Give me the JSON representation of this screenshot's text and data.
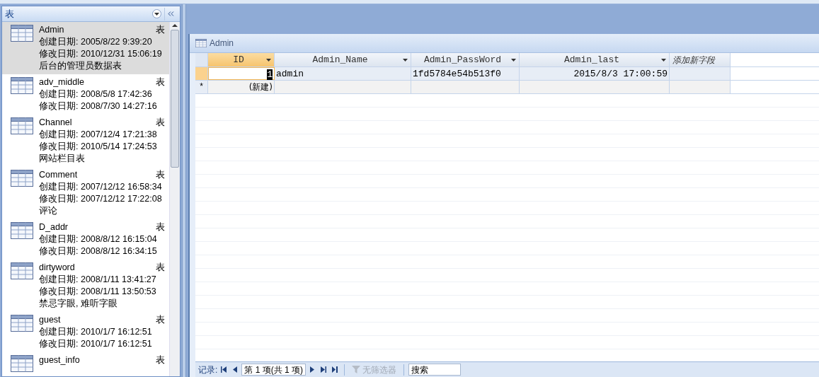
{
  "navigation_pane": {
    "title": "表",
    "items": [
      {
        "name": "Admin",
        "type_label": "表",
        "created": "创建日期: 2005/8/22 9:39:20",
        "modified": "修改日期: 2010/12/31 15:06:19",
        "description": "后台的管理员数据表",
        "selected": true
      },
      {
        "name": "adv_middle",
        "type_label": "表",
        "created": "创建日期: 2008/5/8 17:42:36",
        "modified": "修改日期: 2008/7/30 14:27:16",
        "selected": false
      },
      {
        "name": "Channel",
        "type_label": "表",
        "created": "创建日期: 2007/12/4 17:21:38",
        "modified": "修改日期: 2010/5/14 17:24:53",
        "description": "网站栏目表",
        "selected": false
      },
      {
        "name": "Comment",
        "type_label": "表",
        "created": "创建日期: 2007/12/12 16:58:34",
        "modified": "修改日期: 2007/12/12 17:22:08",
        "description": "评论",
        "selected": false
      },
      {
        "name": "D_addr",
        "type_label": "表",
        "created": "创建日期: 2008/8/12 16:15:04",
        "modified": "修改日期: 2008/8/12 16:34:15",
        "selected": false
      },
      {
        "name": "dirtyword",
        "type_label": "表",
        "created": "创建日期: 2008/1/11 13:41:27",
        "modified": "修改日期: 2008/1/11 13:50:53",
        "description": "禁忌字眼, 难听字眼",
        "selected": false
      },
      {
        "name": "guest",
        "type_label": "表",
        "created": "创建日期: 2010/1/7 16:12:51",
        "modified": "修改日期: 2010/1/7 16:12:51",
        "selected": false
      },
      {
        "name": "guest_info",
        "type_label": "表",
        "selected": false
      }
    ]
  },
  "document": {
    "tab_title": "Admin",
    "columns": [
      {
        "label": "ID",
        "kind": "number",
        "selected": true
      },
      {
        "label": "Admin_Name",
        "kind": "text",
        "selected": false
      },
      {
        "label": "Admin_PassWord",
        "kind": "text",
        "selected": false
      },
      {
        "label": "Admin_last",
        "kind": "date",
        "selected": false
      },
      {
        "label": "添加新字段",
        "kind": "add",
        "selected": false
      }
    ],
    "rows": [
      {
        "kind": "record",
        "current": true,
        "cells": [
          "1",
          "admin",
          "1fd5784e54b513f0",
          "2015/8/3 17:00:59",
          ""
        ]
      },
      {
        "kind": "new",
        "current": false,
        "selector": "*",
        "cells": [
          "(新建)",
          "",
          "",
          "",
          ""
        ]
      }
    ]
  },
  "status_bar": {
    "label": "记录:",
    "position": "第 1 项(共 1 项)",
    "filter": {
      "label": "无筛选器",
      "disabled": true
    },
    "search": {
      "placeholder": "搜索"
    }
  }
}
